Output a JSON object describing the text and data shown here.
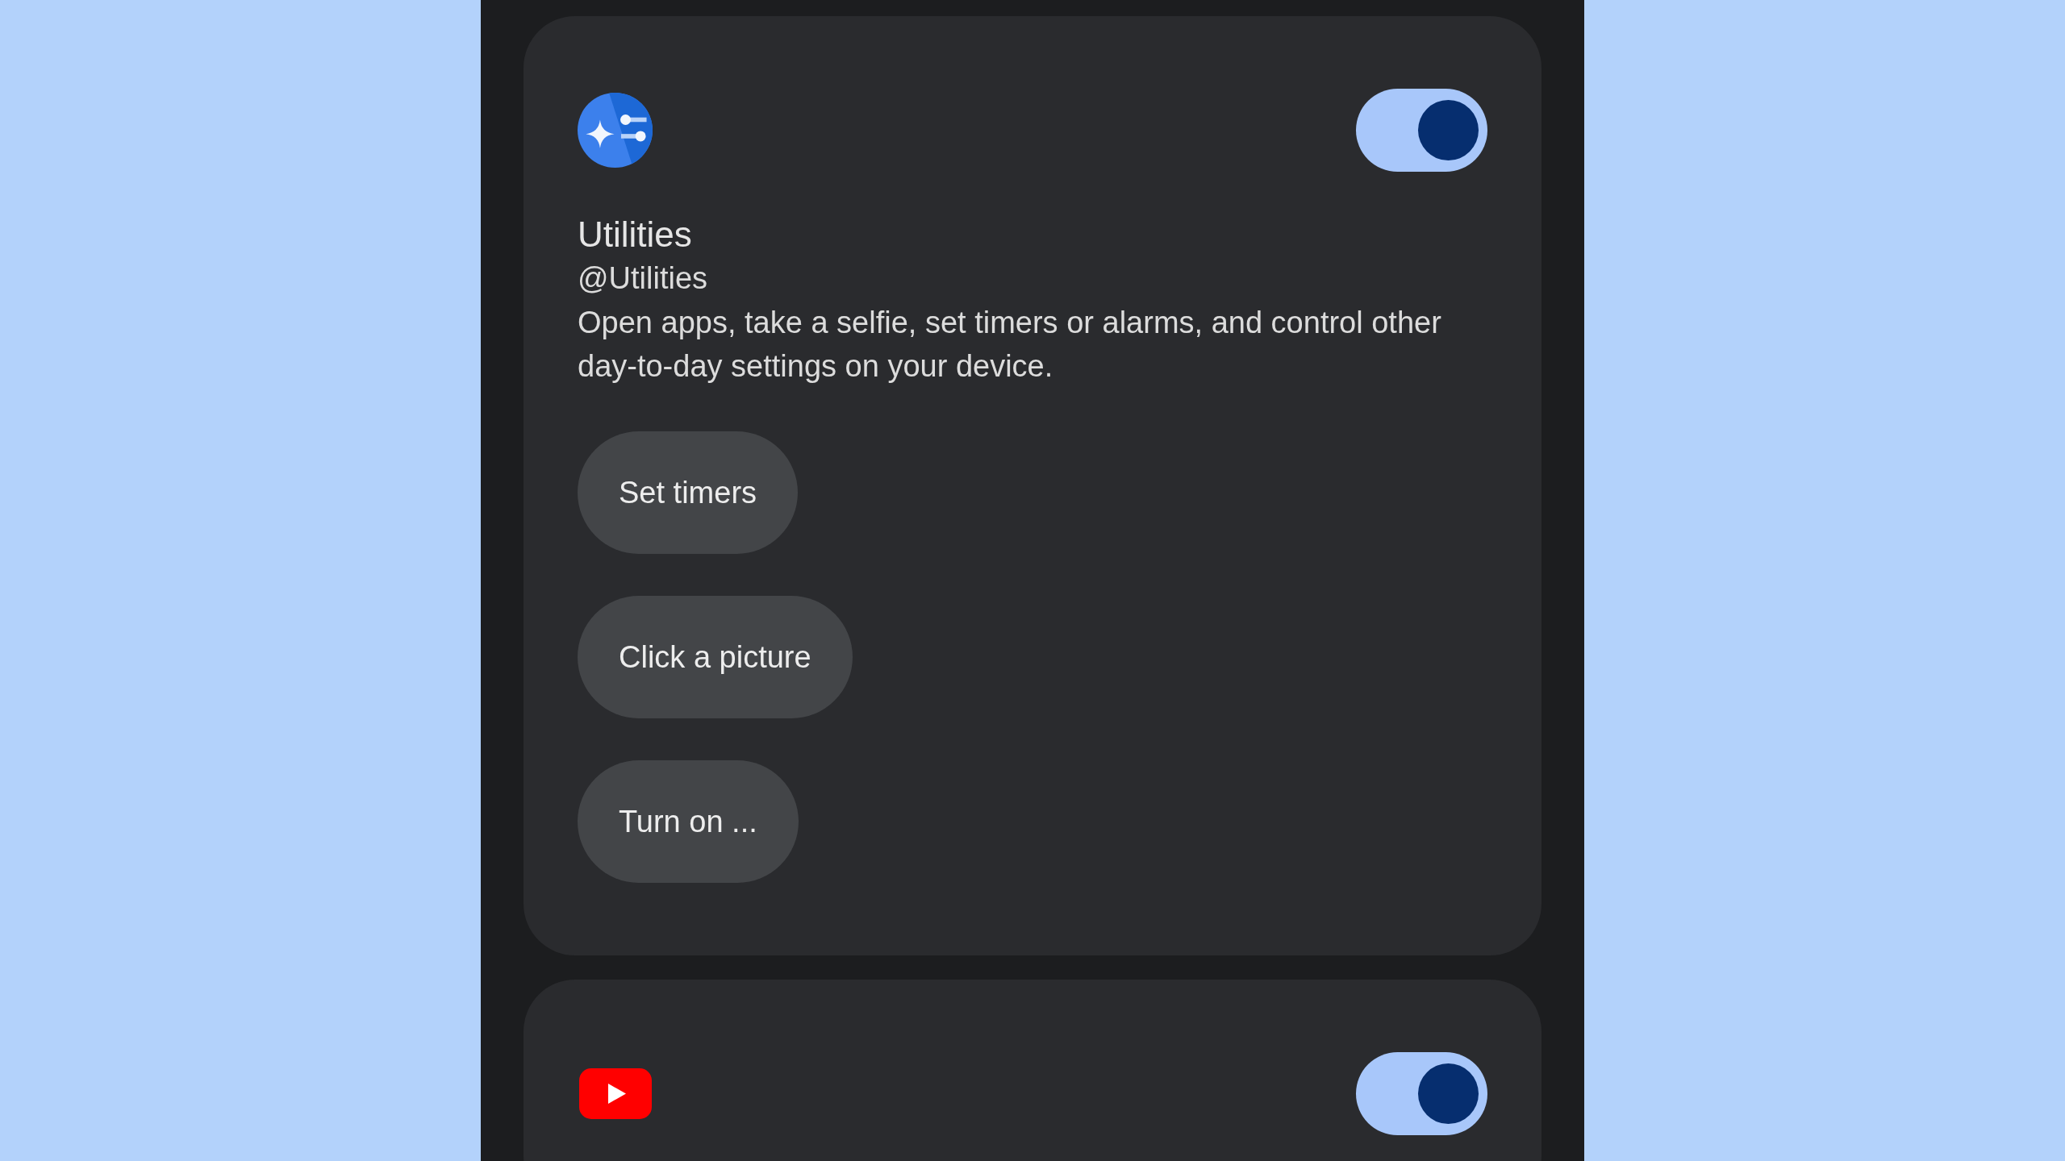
{
  "cards": [
    {
      "kind": "utility",
      "on": true,
      "title": "Utilities",
      "handle": "@Utilities",
      "description": "Open apps, take a selfie, set timers or alarms, and control other day-to-day settings on your device.",
      "suggestions": [
        "Set timers",
        "Click a picture",
        "Turn on ..."
      ]
    },
    {
      "kind": "video",
      "on": true
    }
  ]
}
